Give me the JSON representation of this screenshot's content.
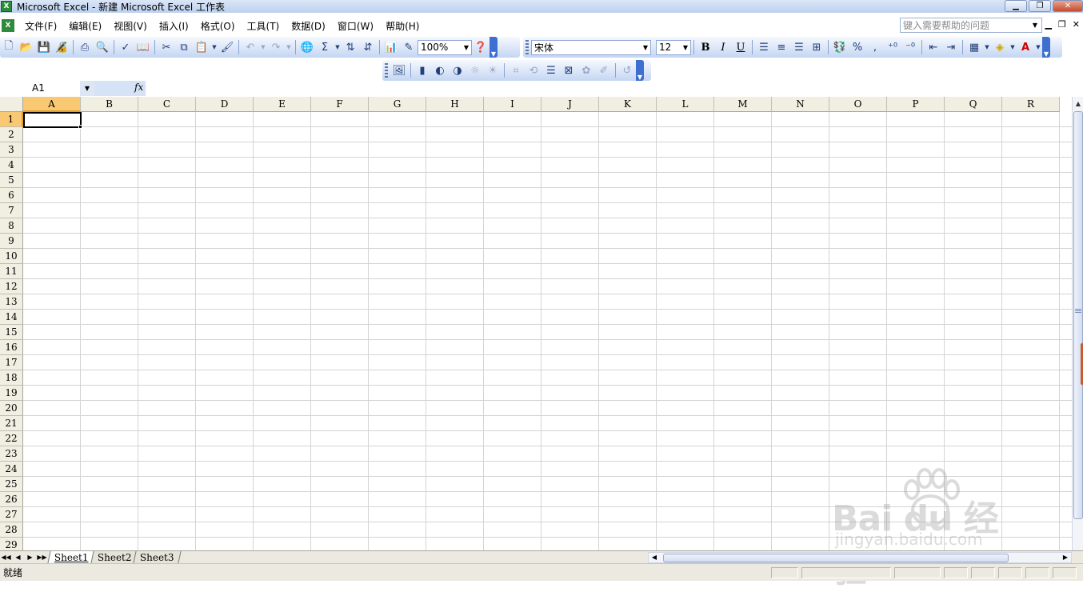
{
  "window": {
    "title": "Microsoft Excel - 新建 Microsoft Excel 工作表",
    "app_icon_text": "X"
  },
  "menu": {
    "items": [
      "文件(F)",
      "编辑(E)",
      "视图(V)",
      "插入(I)",
      "格式(O)",
      "工具(T)",
      "数据(D)",
      "窗口(W)",
      "帮助(H)"
    ],
    "help_placeholder": "键入需要帮助的问题"
  },
  "toolbar": {
    "zoom": "100%",
    "font_name": "宋体",
    "font_size": "12",
    "bold": "B",
    "italic": "I",
    "underline": "U",
    "sum": "Σ",
    "percent": "%",
    "comma": ","
  },
  "formula_bar": {
    "name_box": "A1",
    "fx": "fx"
  },
  "grid": {
    "columns": [
      "A",
      "B",
      "C",
      "D",
      "E",
      "F",
      "G",
      "H",
      "I",
      "J",
      "K",
      "L",
      "M",
      "N",
      "O",
      "P",
      "Q",
      "R"
    ],
    "rows": [
      "1",
      "2",
      "3",
      "4",
      "5",
      "6",
      "7",
      "8",
      "9",
      "10",
      "11",
      "12",
      "13",
      "14",
      "15",
      "16",
      "17",
      "18",
      "19",
      "20",
      "21",
      "22",
      "23",
      "24",
      "25",
      "26",
      "27",
      "28",
      "29"
    ],
    "active_column": "A",
    "active_row": "1"
  },
  "sheets": {
    "tabs": [
      "Sheet1",
      "Sheet2",
      "Sheet3"
    ],
    "active": "Sheet1"
  },
  "status": {
    "text": "就绪"
  },
  "watermark": {
    "brand": "Bai du 经验",
    "url": "jingyan.baidu.com"
  }
}
